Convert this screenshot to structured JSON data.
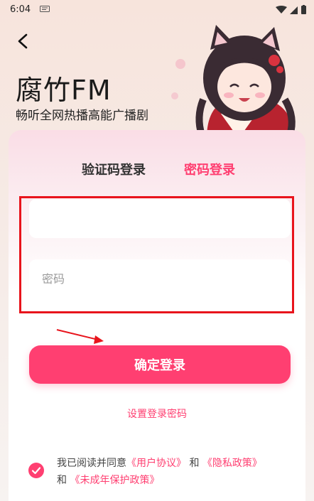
{
  "status_bar": {
    "time": "6:04"
  },
  "app": {
    "title": "腐竹FM",
    "subtitle": "畅听全网热播高能广播剧"
  },
  "tabs": {
    "sms": "验证码登录",
    "password": "密码登录"
  },
  "form": {
    "account_value": "",
    "account_placeholder": "",
    "password_placeholder": "密码",
    "submit": "确定登录"
  },
  "set_password_link": "设置登录密码",
  "agreement": {
    "prefix": "我已阅读并同意",
    "user_agreement": "《用户协议》",
    "and1": "和",
    "privacy_policy": "《隐私政策》",
    "and2": "和",
    "minor_policy": "《未成年保护政策》",
    "checked": true
  },
  "colors": {
    "accent": "#ff3f71",
    "highlight": "#e8141c"
  }
}
